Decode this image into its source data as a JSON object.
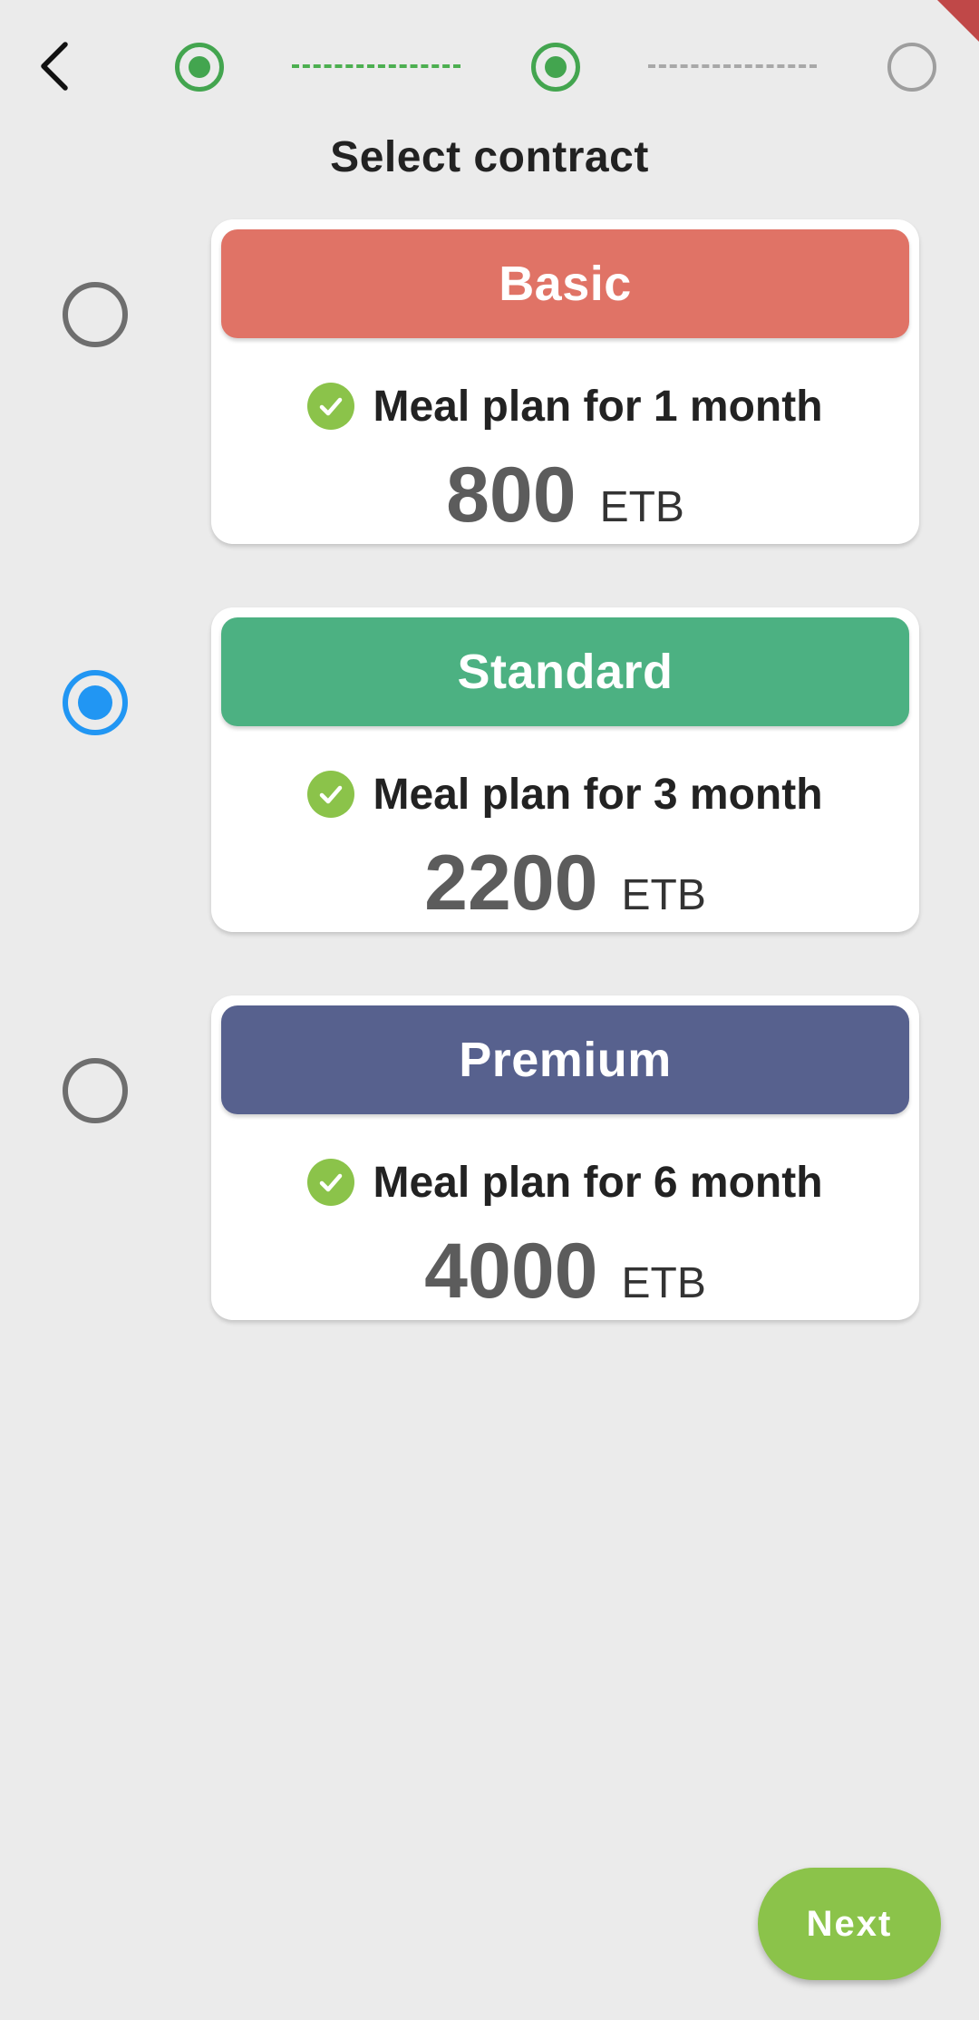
{
  "header": {
    "back_icon": "chevron-left-icon",
    "title": "Select contract"
  },
  "stepper": {
    "steps": [
      {
        "state": "completed"
      },
      {
        "state": "completed"
      },
      {
        "state": "pending"
      }
    ],
    "colors": {
      "done": "#43a54f",
      "pending": "#9e9e9e"
    }
  },
  "plans": [
    {
      "name": "Basic",
      "color": "#e07366",
      "feature": "Meal plan for 1 month",
      "feature_icon": "check-circle-icon",
      "price": "800",
      "currency": "ETB",
      "selected": false
    },
    {
      "name": "Standard",
      "color": "#4cb182",
      "feature": "Meal plan for 3 month",
      "feature_icon": "check-circle-icon",
      "price": "2200",
      "currency": "ETB",
      "selected": true
    },
    {
      "name": "Premium",
      "color": "#57618e",
      "feature": "Meal plan for 6 month",
      "feature_icon": "check-circle-icon",
      "price": "4000",
      "currency": "ETB",
      "selected": false
    }
  ],
  "footer": {
    "next_label": "Next",
    "next_color": "#8bc34a"
  },
  "theme": {
    "background": "#ebebeb",
    "radio_selected": "#2196f3",
    "check_color": "#8bc34a"
  }
}
